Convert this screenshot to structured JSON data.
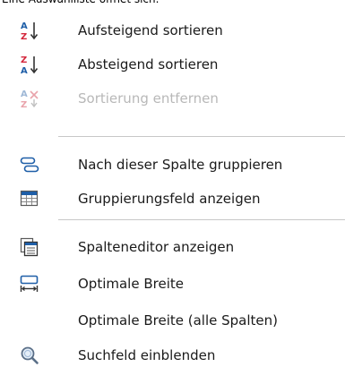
{
  "caption": "Eine Auswahlliste öffnet sich.",
  "colors": {
    "red": "#d4263b",
    "blue": "#1f5fa8",
    "disabled": "#c0c0c0",
    "separator": "#c8c8c8"
  },
  "menu": {
    "items": [
      {
        "label": "Aufsteigend sortieren",
        "icon": "sort-ascending-icon",
        "disabled": false
      },
      {
        "label": "Absteigend sortieren",
        "icon": "sort-descending-icon",
        "disabled": false
      },
      {
        "label": "Sortierung entfernen",
        "icon": "clear-sort-icon",
        "disabled": true
      },
      {
        "label": "Nach dieser Spalte gruppieren",
        "icon": "group-by-column-icon",
        "disabled": false
      },
      {
        "label": "Gruppierungsfeld anzeigen",
        "icon": "group-panel-icon",
        "disabled": false
      },
      {
        "label": "Spalteneditor anzeigen",
        "icon": "column-chooser-icon",
        "disabled": false
      },
      {
        "label": "Optimale Breite",
        "icon": "best-fit-icon",
        "disabled": false
      },
      {
        "label": "Optimale Breite (alle Spalten)",
        "icon": "",
        "disabled": false
      },
      {
        "label": "Suchfeld einblenden",
        "icon": "search-icon",
        "disabled": false
      }
    ]
  }
}
